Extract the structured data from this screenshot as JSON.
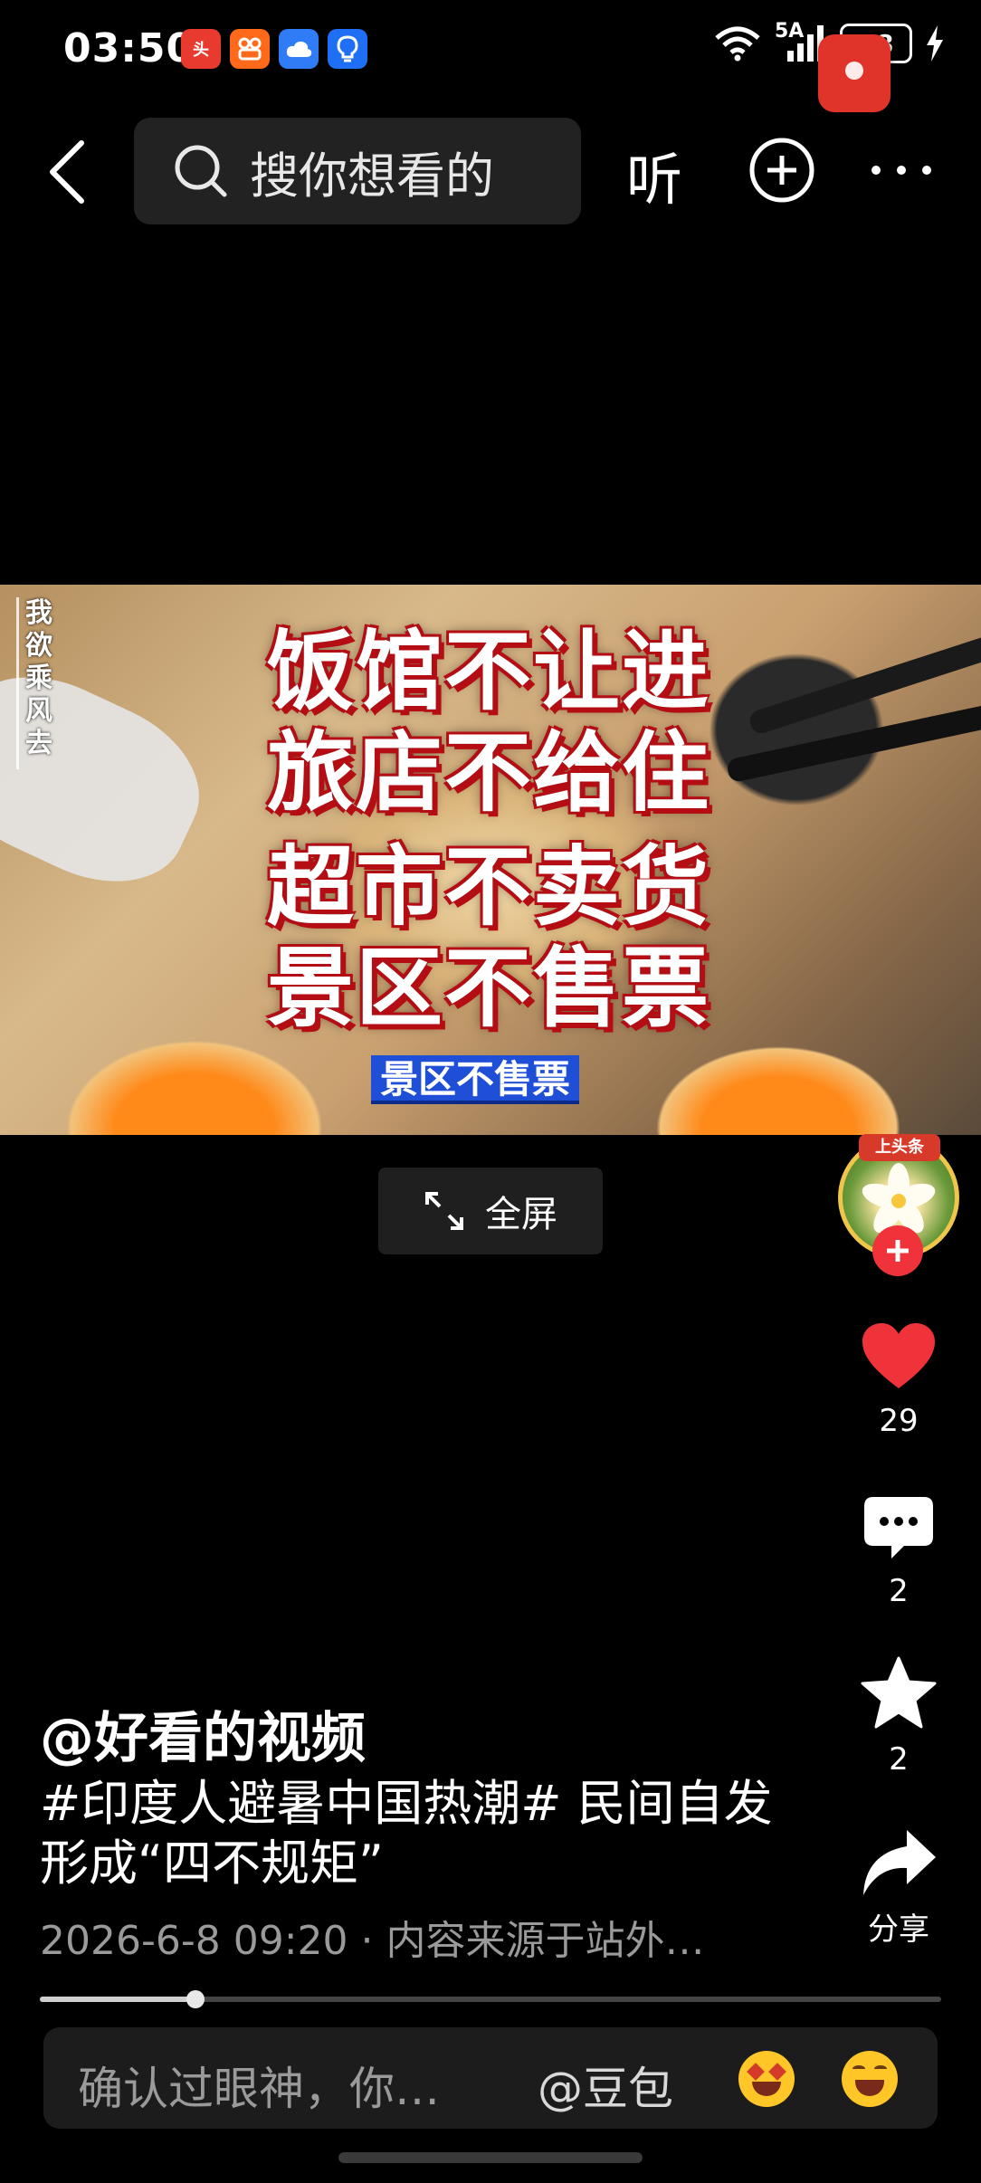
{
  "status_bar": {
    "time": "03:50",
    "network": "5A",
    "battery": "48",
    "app_icons": [
      "toutiao-icon",
      "app-orange-icon",
      "cloud-icon",
      "bulb-icon"
    ]
  },
  "nav": {
    "search_placeholder": "搜你想看的",
    "listen_label": "听"
  },
  "video": {
    "watermark_vertical": "我欲乘风去",
    "caption_lines": [
      "饭馆不让进",
      "旅店不给住",
      "超市不卖货",
      "景区不售票"
    ],
    "subtitle": "景区不售票",
    "fullscreen_label": "全屏"
  },
  "rail": {
    "avatar_badge": "上头条",
    "likes": "29",
    "comments": "2",
    "favorites": "2",
    "share_label": "分享"
  },
  "post": {
    "author": "@好看的视频",
    "description": "#印度人避暑中国热潮# 民间自发形成“四不规矩”",
    "meta": "2026-6-8 09:20 · 内容来源于站外…"
  },
  "playback": {
    "progress": 0.173
  },
  "comment_bar": {
    "placeholder": "确认过眼神，你…",
    "mention": "@豆包"
  },
  "colors": {
    "like": "#f0323a",
    "follow": "#f0323a",
    "subtitle_bg": "#1f4fd6"
  }
}
